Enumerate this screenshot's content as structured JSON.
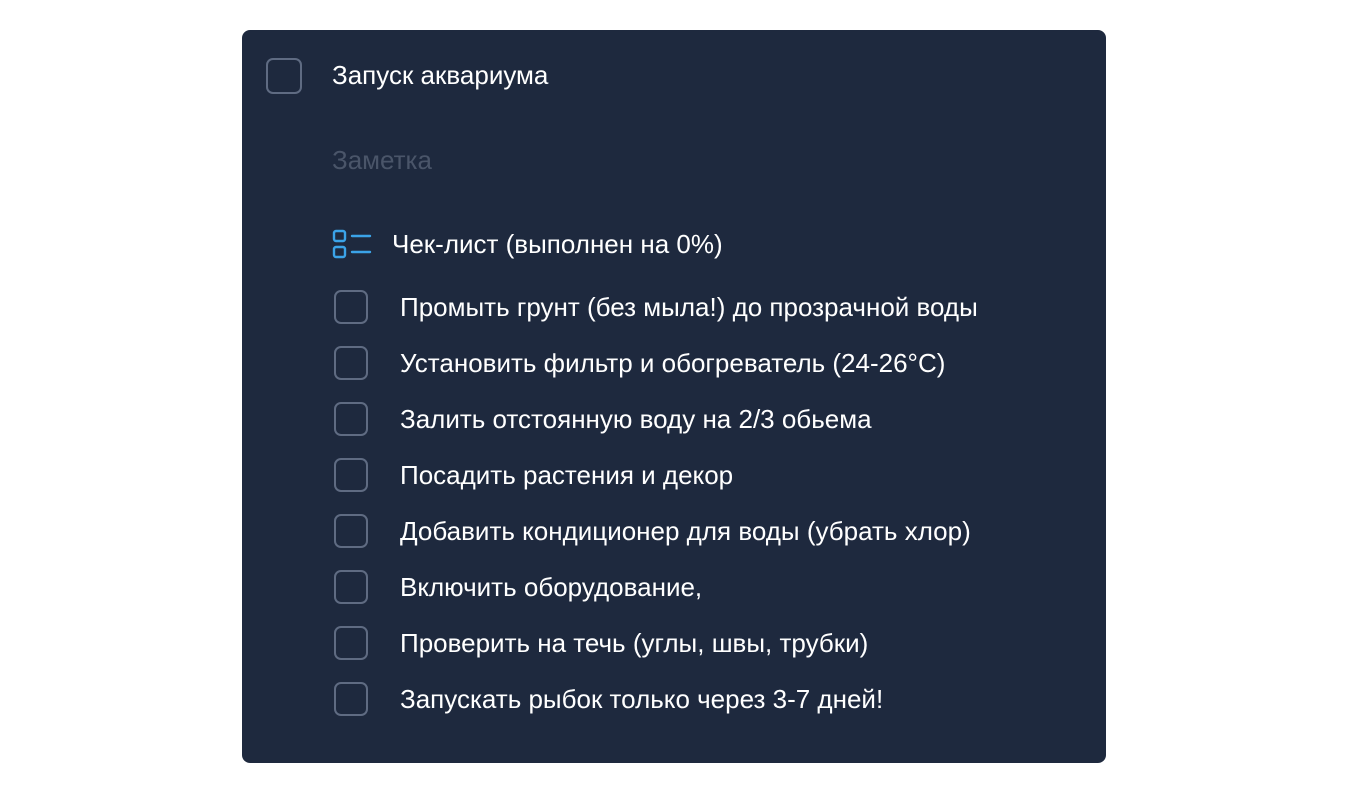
{
  "task": {
    "title": "Запуск аквариума",
    "note_placeholder": "Заметка"
  },
  "checklist": {
    "title": "Чек-лист (выполнен на 0%)",
    "progress_percent": 0,
    "icon": "checklist-icon",
    "items": [
      {
        "label": "Промыть грунт (без мыла!) до прозрачной воды",
        "checked": false
      },
      {
        "label": "Установить фильтр и обогреватель (24-26°C)",
        "checked": false
      },
      {
        "label": "Залить отстоянную воду на 2/3 обьема",
        "checked": false
      },
      {
        "label": "Посадить растения и декор",
        "checked": false
      },
      {
        "label": "Добавить кондиционер для воды (убрать хлор)",
        "checked": false
      },
      {
        "label": "Включить оборудование,",
        "checked": false
      },
      {
        "label": "Проверить на течь (углы, швы, трубки)",
        "checked": false
      },
      {
        "label": "Запускать рыбок только через 3-7 дней!",
        "checked": false
      }
    ]
  },
  "colors": {
    "card_background": "#1e293e",
    "accent": "#3ba3e8",
    "checkbox_border": "#5f6b82",
    "text": "#ffffff",
    "placeholder": "#4a5569"
  }
}
